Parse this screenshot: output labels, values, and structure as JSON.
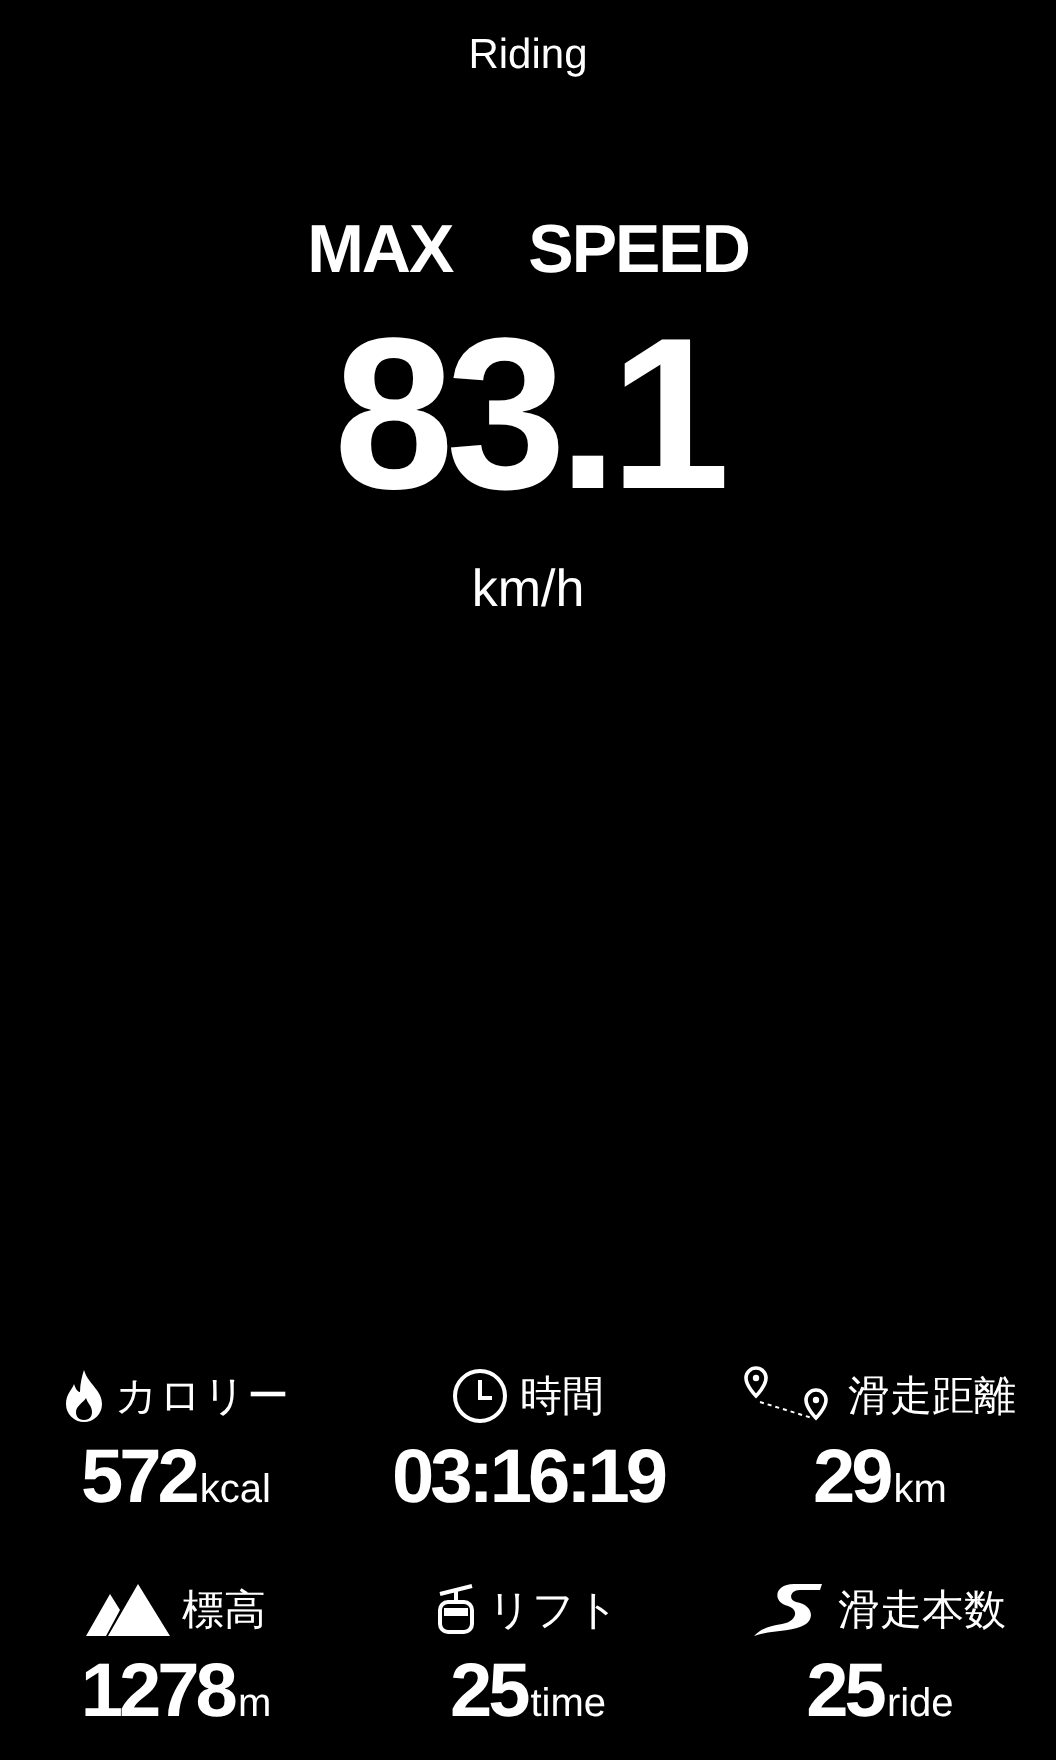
{
  "header": {
    "title": "Riding"
  },
  "main_stat": {
    "label_words": [
      "MAX",
      "SPEED"
    ],
    "value": "83.1",
    "unit": "km/h"
  },
  "stats": [
    {
      "kind": "flame",
      "label": "カロリー",
      "value": "572",
      "unit": "kcal"
    },
    {
      "kind": "clock",
      "label": "時間",
      "value": "03:16:19"
    },
    {
      "kind": "route",
      "label": "滑走距離",
      "value": "29",
      "unit": "km"
    },
    {
      "kind": "mountain",
      "label": "標高",
      "value": "1278",
      "unit": "m"
    },
    {
      "kind": "gondola",
      "label": "リフト",
      "value": "25",
      "unit": "time"
    },
    {
      "kind": "slope",
      "label": "滑走本数",
      "value": "25",
      "unit": "ride"
    }
  ]
}
